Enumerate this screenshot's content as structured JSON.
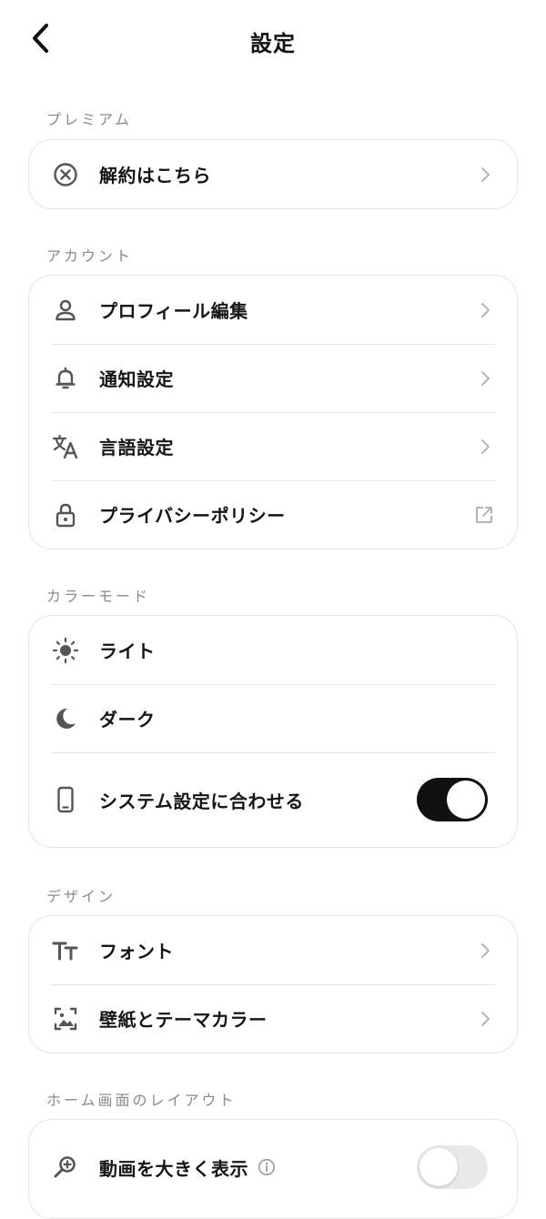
{
  "header": {
    "title": "設定"
  },
  "sections": {
    "premium": {
      "label": "プレミアム",
      "items": [
        {
          "label": "解約はこちら",
          "icon": "circle-x-icon"
        }
      ]
    },
    "account": {
      "label": "アカウント",
      "items": [
        {
          "label": "プロフィール編集",
          "icon": "person-icon"
        },
        {
          "label": "通知設定",
          "icon": "bell-icon"
        },
        {
          "label": "言語設定",
          "icon": "translate-icon"
        },
        {
          "label": "プライバシーポリシー",
          "icon": "lock-icon"
        }
      ]
    },
    "color_mode": {
      "label": "カラーモード",
      "items": [
        {
          "label": "ライト",
          "icon": "sun-icon"
        },
        {
          "label": "ダーク",
          "icon": "moon-icon"
        },
        {
          "label": "システム設定に合わせる",
          "icon": "phone-icon",
          "toggle_on": true
        }
      ]
    },
    "design": {
      "label": "デザイン",
      "items": [
        {
          "label": "フォント",
          "icon": "font-size-icon"
        },
        {
          "label": "壁紙とテーマカラー",
          "icon": "wallpaper-icon"
        }
      ]
    },
    "home_layout": {
      "label": "ホーム画面のレイアウト",
      "items": [
        {
          "label": "動画を大きく表示",
          "icon": "zoom-icon",
          "toggle_on": false
        }
      ]
    }
  },
  "colors": {
    "accent": "#111111",
    "divider": "#e8e8e8",
    "label_gray": "#8a8a8a"
  }
}
